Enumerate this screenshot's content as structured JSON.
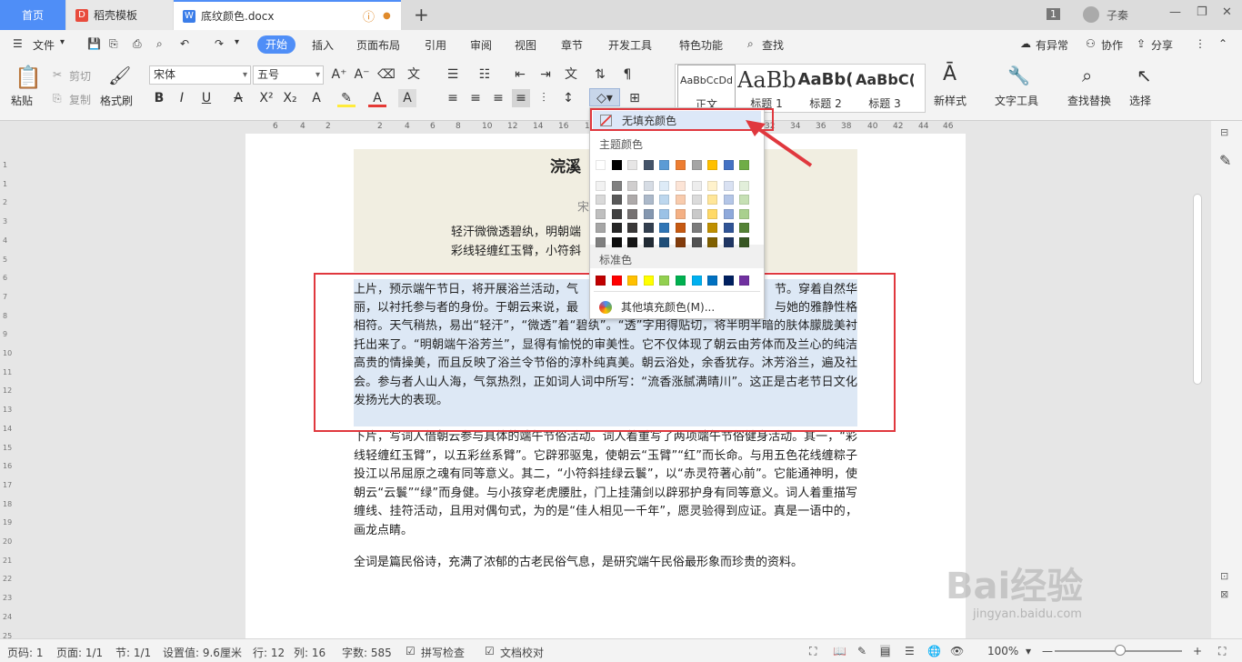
{
  "tabs": {
    "home": "首页",
    "daoke": "稻壳模板",
    "doc": "底纹颜色.docx",
    "user": "子秦",
    "badge": "1"
  },
  "menu": {
    "file": "文件",
    "items": [
      "开始",
      "插入",
      "页面布局",
      "引用",
      "审阅",
      "视图",
      "章节",
      "开发工具",
      "特色功能"
    ],
    "search": "查找",
    "right": [
      "有异常",
      "协作",
      "分享"
    ]
  },
  "ribbon": {
    "paste": "粘贴",
    "cut": "剪切",
    "copy": "复制",
    "format_painter": "格式刷",
    "font_name": "宋体",
    "font_size": "五号",
    "styles": [
      {
        "preview": "AaBbCcDd",
        "name": "正文"
      },
      {
        "preview": "AaBb",
        "name": "标题 1"
      },
      {
        "preview": "AaBb(",
        "name": "标题 2"
      },
      {
        "preview": "AaBbC(",
        "name": "标题 3"
      }
    ],
    "new_style": "新样式",
    "text_tools": "文字工具",
    "find_replace": "查找替换",
    "select": "选择"
  },
  "ruler": {
    "h": [
      "6",
      "4",
      "2",
      "2",
      "4",
      "6",
      "8",
      "10",
      "12",
      "14",
      "16",
      "18",
      "20",
      "22",
      "24",
      "26",
      "28",
      "30",
      "32",
      "34",
      "36",
      "38",
      "40",
      "42",
      "44",
      "46"
    ],
    "v": [
      "1",
      "1",
      "2",
      "3",
      "4",
      "5",
      "6",
      "7",
      "8",
      "9",
      "10",
      "11",
      "12",
      "13",
      "14",
      "15",
      "16",
      "17",
      "18",
      "19",
      "20",
      "21",
      "22",
      "23",
      "24",
      "25",
      "26",
      "27"
    ]
  },
  "document": {
    "title": "浣溪",
    "author": "宋",
    "poem1": "轻汗微微透碧纨，明朝端",
    "poem2": "彩线轻缠红玉臂，小符斜",
    "para1_left": "上片，预示端午节日，将开展浴兰活动，气",
    "para1_end": "节。穿着自然华",
    "para1_rest": "丽，以衬托参与者的身份。于朝云来说，最",
    "para1_rest_end": "与她的雅静性格",
    "para1_body": "相符。天气稍热，易出“轻汗”，“微透”着“碧纨”。“透”字用得贴切，将半明半暗的肤体朦胧美衬托出来了。“明朝端午浴芳兰”，显得有愉悦的审美性。它不仅体现了朝云由芳体而及兰心的纯洁高贵的情操美，而且反映了浴兰令节俗的淳朴纯真美。朝云浴处，余香犹存。沐芳浴兰，遍及社会。参与者人山人海，气氛热烈，正如词人词中所写：“流香涨腻满晴川”。这正是古老节日文化发扬光大的表现。",
    "para2": "下片，写词人借朝云参与具体的端午节俗活动。词人着重写了两项端午节俗健身活动。其一，“彩线轻缠红玉臂”，以五彩丝系臂”。它辟邪驱鬼，使朝云“玉臂”“红”而长命。与用五色花线缠粽子投江以吊屈原之魂有同等意义。其二，“小符斜挂绿云鬟”，以“赤灵符著心前”。它能通神明，使朝云“云鬟”“绿”而身健。与小孩穿老虎腰肚，门上挂蒲剑以辟邪护身有同等意义。词人着重描写缠线、挂符活动，且用对偶句式，为的是“佳人相见一千年”，愿灵验得到应证。真是一语中的，画龙点睛。",
    "para3": "全词是篇民俗诗，充满了浓郁的古老民俗气息，是研究端午民俗最形象而珍贵的资料。"
  },
  "dropdown": {
    "no_fill": "无填充颜色",
    "theme_label": "主题颜色",
    "standard_label": "标准色",
    "more": "其他填充颜色(M)...",
    "theme_top": [
      "#ffffff",
      "#000000",
      "#e7e6e6",
      "#44546a",
      "#5b9bd5",
      "#ed7d31",
      "#a5a5a5",
      "#ffc000",
      "#4472c4",
      "#70ad47"
    ],
    "theme_shades": [
      [
        "#f2f2f2",
        "#808080",
        "#d0cece",
        "#d6dce4",
        "#ddebf7",
        "#fce4d6",
        "#ededed",
        "#fff2cc",
        "#d9e1f2",
        "#e2efda"
      ],
      [
        "#d9d9d9",
        "#595959",
        "#aeaaaa",
        "#acb9ca",
        "#bdd7ee",
        "#f8cbad",
        "#dbdbdb",
        "#ffe699",
        "#b4c6e7",
        "#c6e0b4"
      ],
      [
        "#bfbfbf",
        "#404040",
        "#757171",
        "#8497b0",
        "#9bc2e6",
        "#f4b084",
        "#c9c9c9",
        "#ffd966",
        "#8ea9db",
        "#a9d08e"
      ],
      [
        "#a6a6a6",
        "#262626",
        "#3a3838",
        "#333f4f",
        "#2f75b5",
        "#c65911",
        "#7b7b7b",
        "#bf8f00",
        "#305496",
        "#548235"
      ],
      [
        "#808080",
        "#0d0d0d",
        "#161616",
        "#222b35",
        "#1f4e78",
        "#833c0c",
        "#525252",
        "#806000",
        "#203764",
        "#375623"
      ]
    ],
    "standard": [
      "#c00000",
      "#ff0000",
      "#ffc000",
      "#ffff00",
      "#92d050",
      "#00b050",
      "#00b0f0",
      "#0070c0",
      "#002060",
      "#7030a0"
    ]
  },
  "status": {
    "page": "页码: 1",
    "pages": "页面: 1/1",
    "section": "节: 1/1",
    "setting": "设置值: 9.6厘米",
    "row": "行: 12",
    "col": "列: 16",
    "words": "字数: 585",
    "spell": "拼写检查",
    "proof": "文档校对",
    "zoom": "100%"
  },
  "watermark": {
    "main": "Bai经验",
    "sub": "jingyan.baidu.com"
  },
  "colors": {
    "accent": "#4f8ef7",
    "highlight": "#e0383e"
  }
}
